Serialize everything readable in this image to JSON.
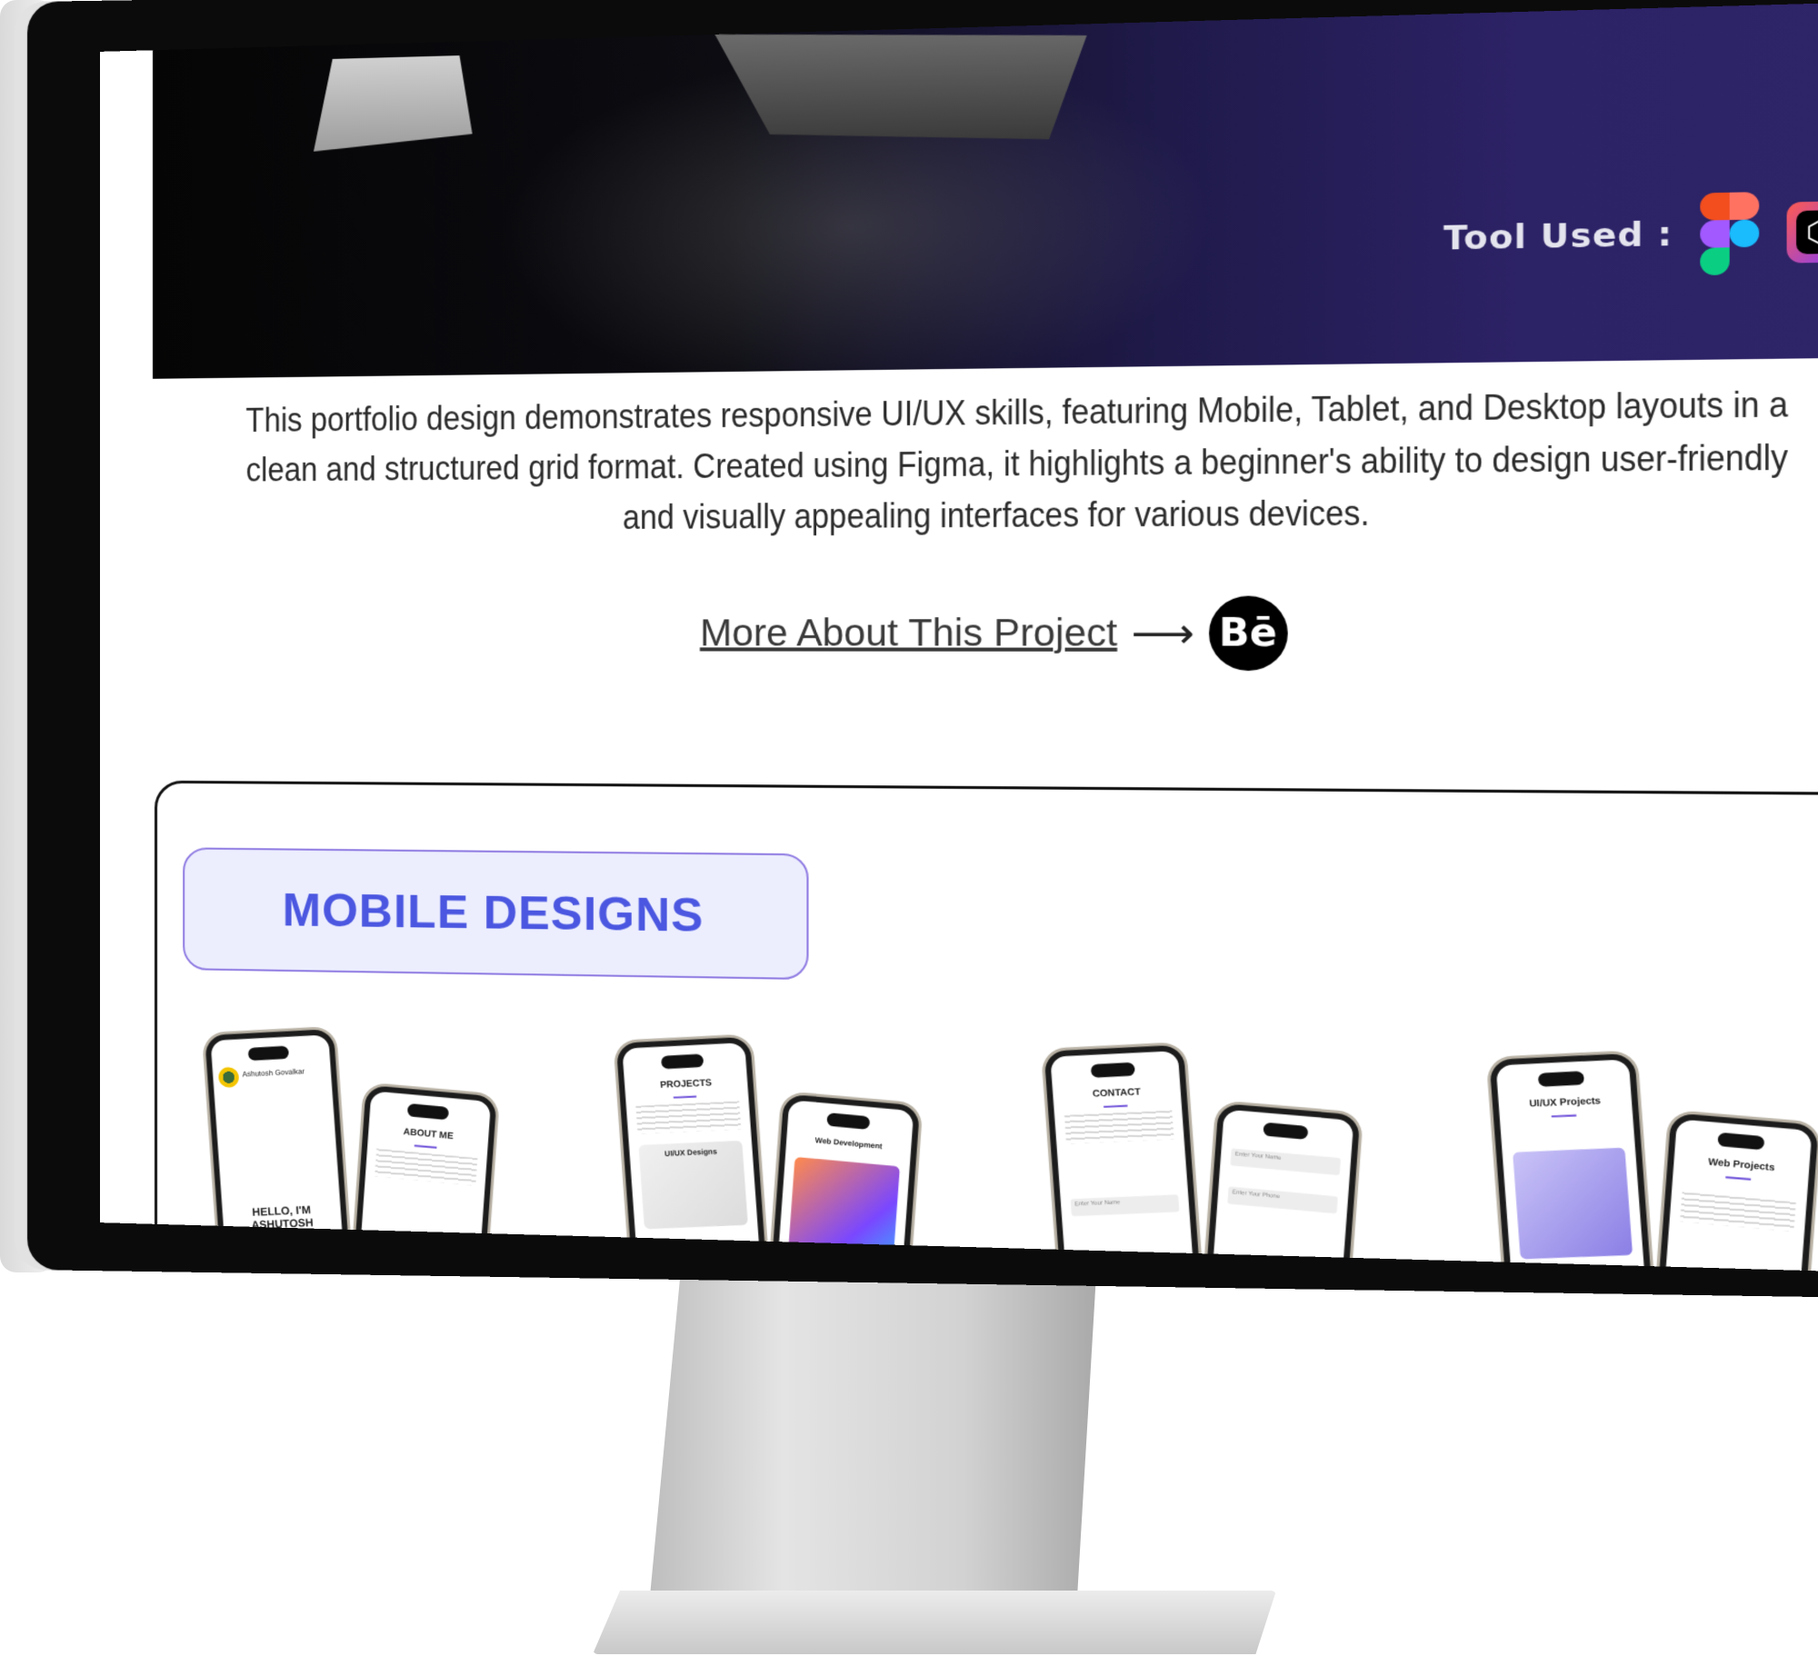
{
  "hero": {
    "tools_label": "Tool Used :",
    "tools": [
      "figma-icon",
      "protopie-icon"
    ]
  },
  "description": "This portfolio design demonstrates responsive UI/UX skills, featuring Mobile, Tablet, and Desktop layouts in a clean and structured grid format. Created using Figma, it highlights a beginner's ability to design user-friendly and visually appealing interfaces for various devices.",
  "more_link": {
    "label": "More About This Project",
    "arrow": "⟶",
    "behance_label": "Bē"
  },
  "mobile_section": {
    "title": "MOBILE DESIGNS",
    "phones": [
      {
        "back": {
          "name": "Ashutosh Govalkar",
          "hello": "HELLO, I'M ASHUTOSH GOVALKAR"
        },
        "front": {
          "heading": "ABOUT ME"
        }
      },
      {
        "back": {
          "heading": "PROJECTS",
          "card": "UI/UX Designs"
        },
        "front": {
          "heading": "Web Development"
        }
      },
      {
        "back": {
          "heading": "CONTACT",
          "field": "Enter Your Name"
        },
        "front": {
          "field1": "Enter Your Name",
          "field2": "Enter Your Phone"
        }
      },
      {
        "back": {
          "heading": "UI/UX Projects"
        },
        "front": {
          "heading": "Web Projects"
        }
      }
    ]
  },
  "colors": {
    "accent": "#4b57e0",
    "chip_bg": "#eceefe",
    "hero_purple": "#2e2468"
  }
}
